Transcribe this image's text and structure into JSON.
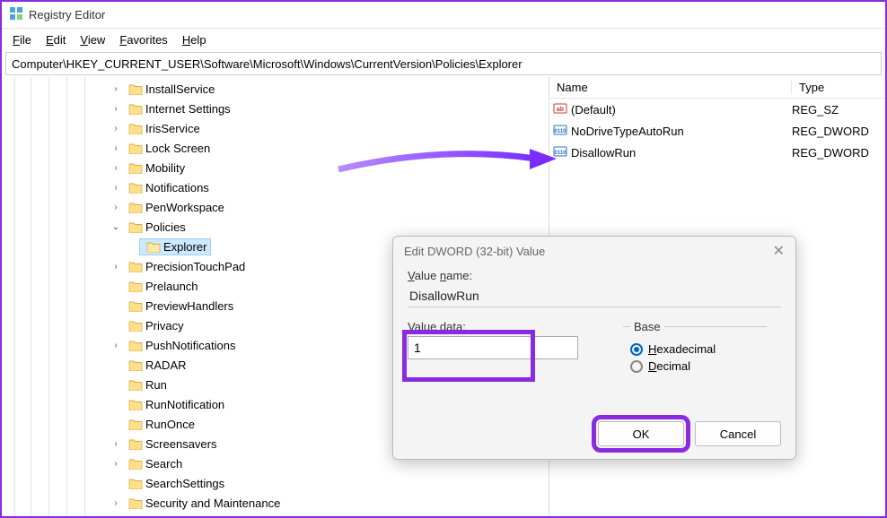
{
  "app": {
    "title": "Registry Editor"
  },
  "menu": {
    "file": "File",
    "edit": "Edit",
    "view": "View",
    "favorites": "Favorites",
    "help": "Help"
  },
  "addressbar": {
    "path": "Computer\\HKEY_CURRENT_USER\\Software\\Microsoft\\Windows\\CurrentVersion\\Policies\\Explorer"
  },
  "tree": [
    {
      "label": "InstallService",
      "expander": "›",
      "indent": 0
    },
    {
      "label": "Internet Settings",
      "expander": "›",
      "indent": 0
    },
    {
      "label": "IrisService",
      "expander": "›",
      "indent": 0
    },
    {
      "label": "Lock Screen",
      "expander": "›",
      "indent": 0
    },
    {
      "label": "Mobility",
      "expander": "›",
      "indent": 0
    },
    {
      "label": "Notifications",
      "expander": "›",
      "indent": 0
    },
    {
      "label": "PenWorkspace",
      "expander": "›",
      "indent": 0
    },
    {
      "label": "Policies",
      "expander": "⌄",
      "indent": 0
    },
    {
      "label": "Explorer",
      "expander": "",
      "indent": 1,
      "selected": true
    },
    {
      "label": "PrecisionTouchPad",
      "expander": "›",
      "indent": 0
    },
    {
      "label": "Prelaunch",
      "expander": "",
      "indent": 0
    },
    {
      "label": "PreviewHandlers",
      "expander": "",
      "indent": 0
    },
    {
      "label": "Privacy",
      "expander": "",
      "indent": 0
    },
    {
      "label": "PushNotifications",
      "expander": "›",
      "indent": 0
    },
    {
      "label": "RADAR",
      "expander": "",
      "indent": 0
    },
    {
      "label": "Run",
      "expander": "",
      "indent": 0
    },
    {
      "label": "RunNotification",
      "expander": "",
      "indent": 0
    },
    {
      "label": "RunOnce",
      "expander": "",
      "indent": 0
    },
    {
      "label": "Screensavers",
      "expander": "›",
      "indent": 0
    },
    {
      "label": "Search",
      "expander": "›",
      "indent": 0
    },
    {
      "label": "SearchSettings",
      "expander": "",
      "indent": 0
    },
    {
      "label": "Security and Maintenance",
      "expander": "›",
      "indent": 0
    }
  ],
  "list": {
    "columns": {
      "name": "Name",
      "type": "Type"
    },
    "rows": [
      {
        "icon": "str",
        "name": "(Default)",
        "type": "REG_SZ"
      },
      {
        "icon": "bin",
        "name": "NoDriveTypeAutoRun",
        "type": "REG_DWORD"
      },
      {
        "icon": "bin",
        "name": "DisallowRun",
        "type": "REG_DWORD"
      }
    ]
  },
  "dialog": {
    "title": "Edit DWORD (32-bit) Value",
    "value_name_label": "Value name:",
    "value_name": "DisallowRun",
    "value_data_label_pre": "V",
    "value_data_label_u": "a",
    "value_data_label_post": "lue data:",
    "value_data": "1",
    "base_label": "Base",
    "hex_pre": "H",
    "hex_post": "exadecimal",
    "dec_pre": "D",
    "dec_post": "ecimal",
    "ok": "OK",
    "cancel": "Cancel"
  }
}
